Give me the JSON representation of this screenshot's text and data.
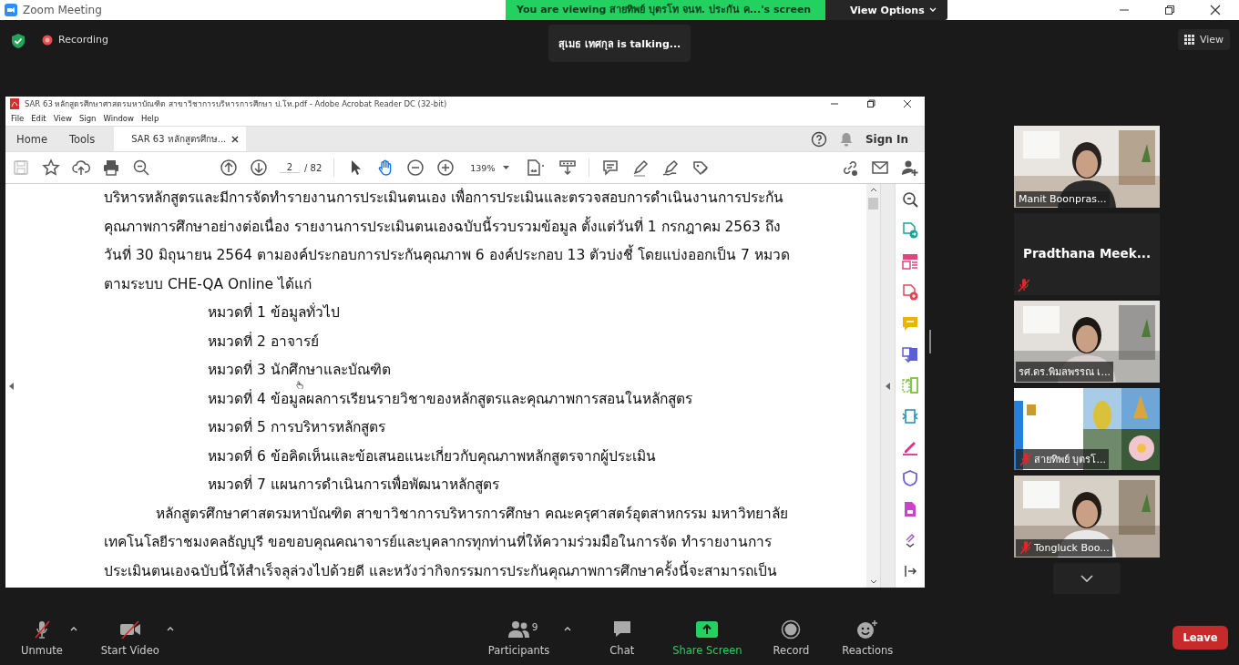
{
  "window": {
    "title": "Zoom Meeting"
  },
  "share_banner": {
    "text": "You are viewing สายทิพย์  บุตรโท จนท. ประกัน ค...'s screen",
    "options": "View Options"
  },
  "recording": {
    "label": "Recording"
  },
  "talking": "สุเมธ เทศกุล is  talking...",
  "view_button": "View",
  "acrobat": {
    "title": "SAR 63 หลักสูตรศึกษาศาสตรมหาบัณฑิต สาขาวิชาการบริหารการศึกษา ป.โท.pdf - Adobe Acrobat Reader DC (32-bit)",
    "menu": [
      "File",
      "Edit",
      "View",
      "Sign",
      "Window",
      "Help"
    ],
    "tabs": [
      {
        "label": "Home",
        "selected": false
      },
      {
        "label": "Tools",
        "selected": false
      },
      {
        "label": "SAR 63 หลักสูตรศึกษ...",
        "selected": true
      }
    ],
    "sign_in": "Sign In",
    "page": "2",
    "page_total": "/ 82",
    "zoom": "139%",
    "lines": [
      {
        "kind": "justify",
        "text": "บริหารหลักสูตรและมีการจัดทำรายงานการประเมินตนเอง เพื่อการประเมินและตรวจสอบการดำเนินงานการประกัน"
      },
      {
        "kind": "justify",
        "text": "คุณภาพการศึกษาอย่างต่อเนื่อง รายงานการประเมินตนเองฉบับนี้รวบรวมข้อมูล ตั้งแต่วันที่ 1 กรกฎาคม 2563 ถึง"
      },
      {
        "kind": "justify",
        "text": "วันที่ 30 มิถุนายน 2564 ตามองค์ประกอบการประกันคุณภาพ 6 องค์ประกอบ 13 ตัวบ่งชี้ โดยแบ่งออกเป็น 7 หมวด"
      },
      {
        "kind": "last",
        "text": "ตามระบบ CHE-QA Online ได้แก่"
      },
      {
        "kind": "item",
        "text": "หมวดที่ 1 ข้อมูลทั่วไป"
      },
      {
        "kind": "item",
        "text": "หมวดที่ 2 อาจารย์"
      },
      {
        "kind": "item",
        "text": "หมวดที่ 3 นักศึกษาและบัณฑิต"
      },
      {
        "kind": "item",
        "text": "หมวดที่ 4 ข้อมูลผลการเรียนรายวิชาของหลักสูตรและคุณภาพการสอนในหลักสูตร"
      },
      {
        "kind": "item",
        "text": "หมวดที่ 5 การบริหารหลักสูตร"
      },
      {
        "kind": "item",
        "text": "หมวดที่ 6 ข้อคิดเห็นและข้อเสนอแนะเกี่ยวกับคุณภาพหลักสูตรจากผู้ประเมิน"
      },
      {
        "kind": "item",
        "text": "หมวดที่ 7 แผนการดำเนินการเพื่อพัฒนาหลักสูตร"
      },
      {
        "kind": "first",
        "text": "หลักสูตรศึกษาศาสตรมหาบัณฑิต สาขาวิชาการบริหารการศึกษา คณะครุศาสตร์อุตสาหกรรม มหาวิทยาลัย"
      },
      {
        "kind": "justify",
        "text": "เทคโนโลยีราชมงคลธัญบุรี ขอขอบคุณคณาจารย์และบุคลากรทุกท่านที่ให้ความร่วมมือในการจัด ทำรายงานการ"
      },
      {
        "kind": "justify",
        "text": "ประเมินตนเองฉบับนี้ให้สำเร็จลุล่วงไปด้วยดี และหวังว่ากิจกรรมการประกันคุณภาพการศึกษาครั้งนี้จะสามารถเป็น"
      }
    ]
  },
  "participants": [
    {
      "name": "Manit Boonpras...",
      "kind": "video",
      "muted": false
    },
    {
      "name": "Pradthana  Meek...",
      "kind": "name",
      "muted": true
    },
    {
      "name": "รศ.ดร.พิมลพรรณ เ...",
      "kind": "video",
      "muted": false
    },
    {
      "name": "สายทิพย์  บุตรโ...",
      "kind": "video",
      "muted": true
    },
    {
      "name": "Tongluck Boo...",
      "kind": "video",
      "muted": true
    }
  ],
  "controls": {
    "audio": {
      "label": "Unmute",
      "muted": true
    },
    "video": {
      "label": "Start Video",
      "off": true
    },
    "participants": {
      "label": "Participants",
      "count": "9"
    },
    "chat": "Chat",
    "share": "Share Screen",
    "record": "Record",
    "reactions": "Reactions",
    "leave": "Leave"
  }
}
